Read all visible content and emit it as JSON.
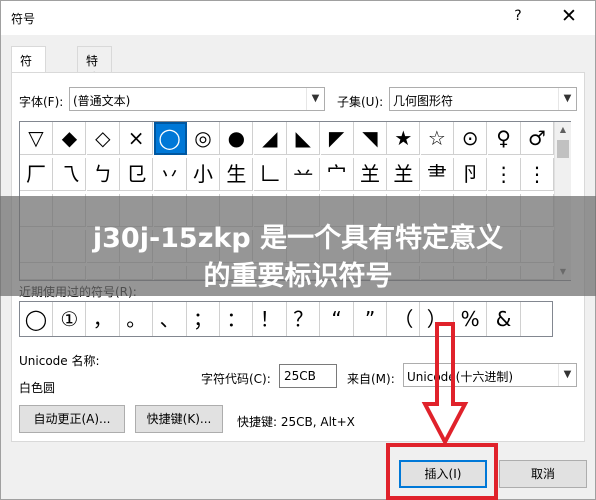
{
  "window": {
    "title": "符号",
    "help_glyph": "?",
    "close_glyph": "✕"
  },
  "tabs": [
    {
      "label": "符号(S)",
      "active": true
    },
    {
      "label": "特殊字符(P)",
      "active": false
    }
  ],
  "font": {
    "label": "字体(F):",
    "value": "(普通文本)"
  },
  "subset": {
    "label": "子集(U):",
    "value": "几何图形符"
  },
  "symbol_grid": {
    "rows": [
      [
        "▽",
        "◆",
        "◇",
        "×",
        "◯",
        "◎",
        "●",
        "◢",
        "◣",
        "◤",
        "◥",
        "★",
        "☆",
        "⊙",
        "♀",
        "♂"
      ],
      [
        "厂",
        "乁",
        "ㄅ",
        "㔾",
        "丷",
        "小",
        "生",
        "𠃊",
        "䒑",
        "宀",
        "𦍌",
        "𦍌",
        "⺻",
        "卪",
        "⋮",
        "⋮"
      ]
    ],
    "selected": {
      "row": 0,
      "col": 4
    }
  },
  "recent": {
    "label": "近期使用过的符号(R):",
    "items": [
      "◯",
      "①",
      "，",
      "。",
      "、",
      "；",
      "：",
      "！",
      "？",
      "“",
      "”",
      "（",
      "）",
      "%",
      "&"
    ]
  },
  "unicode": {
    "name_label": "Unicode 名称:",
    "name_value": "白色圆"
  },
  "char_code": {
    "label": "字符代码(C):",
    "value": "25CB"
  },
  "from": {
    "label": "来自(M):",
    "value": "Unicode(十六进制)"
  },
  "buttons": {
    "autocorrect": "自动更正(A)...",
    "shortcut_key": "快捷键(K)...",
    "shortcut_info": "快捷键: 25CB, Alt+X",
    "insert": "插入(I)",
    "cancel": "取消"
  },
  "overlay": {
    "line1": "j30j-15zkp 是一个具有特定意义",
    "line2": "的重要标识符号"
  },
  "colors": {
    "annotation_red": "#e0222b",
    "selection_blue": "#0078d7"
  }
}
